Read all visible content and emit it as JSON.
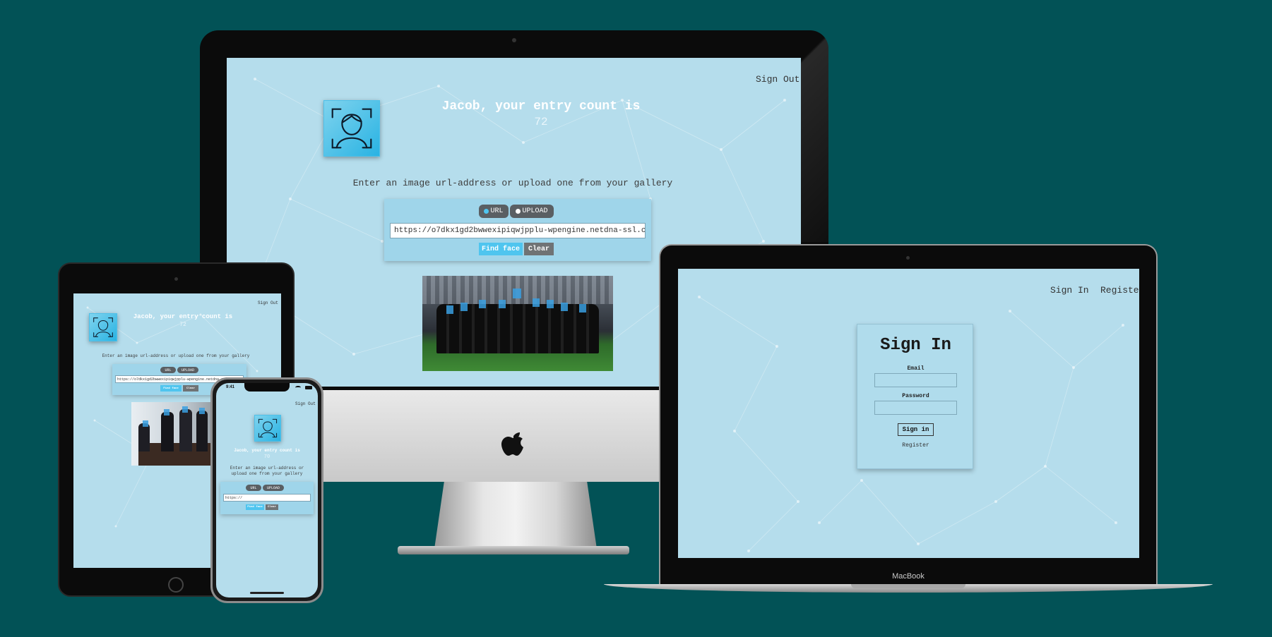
{
  "desktop": {
    "nav": {
      "sign_out": "Sign Out"
    },
    "greeting": "Jacob, your entry count is",
    "count": "72",
    "instructions": "Enter an image url-address or upload one from your gallery",
    "toggle": {
      "url": "URL",
      "upload": "UPLOAD"
    },
    "url_value": "https://o7dkx1gd2bwwexipiqwjpplu-wpengine.netdna-ssl.c",
    "buttons": {
      "find": "Find face",
      "clear": "Clear"
    }
  },
  "tablet": {
    "nav": {
      "sign_out": "Sign Out"
    },
    "greeting": "Jacob, your entry count is",
    "count": "72",
    "instructions": "Enter an image url-address or upload one from your gallery",
    "toggle": {
      "url": "URL",
      "upload": "UPLOAD"
    },
    "url_value": "https://o7dkx1gd2bwwexipiqwjpplu-wpengine.netdna-ssl.c",
    "buttons": {
      "find": "Find face",
      "clear": "Clear"
    }
  },
  "phone": {
    "status": {
      "time": "9:41"
    },
    "nav": {
      "sign_out": "Sign Out"
    },
    "greeting": "Jacob, your entry count is",
    "count": "70",
    "instructions": "Enter an image url-address or upload one from your gallery",
    "toggle": {
      "url": "URL",
      "upload": "UPLOAD"
    },
    "url_value": "https://",
    "buttons": {
      "find": "Find face",
      "clear": "Clear"
    }
  },
  "laptop": {
    "nav": {
      "sign_in": "Sign In",
      "register": "Register"
    },
    "form": {
      "title": "Sign In",
      "email_label": "Email",
      "email_value": "",
      "password_label": "Password",
      "password_value": "",
      "submit": "Sign in",
      "register_link": "Register"
    },
    "brand": "MacBook"
  },
  "colors": {
    "background": "#025256",
    "screen": "#b5ddec",
    "accent": "#4fc5ef"
  }
}
